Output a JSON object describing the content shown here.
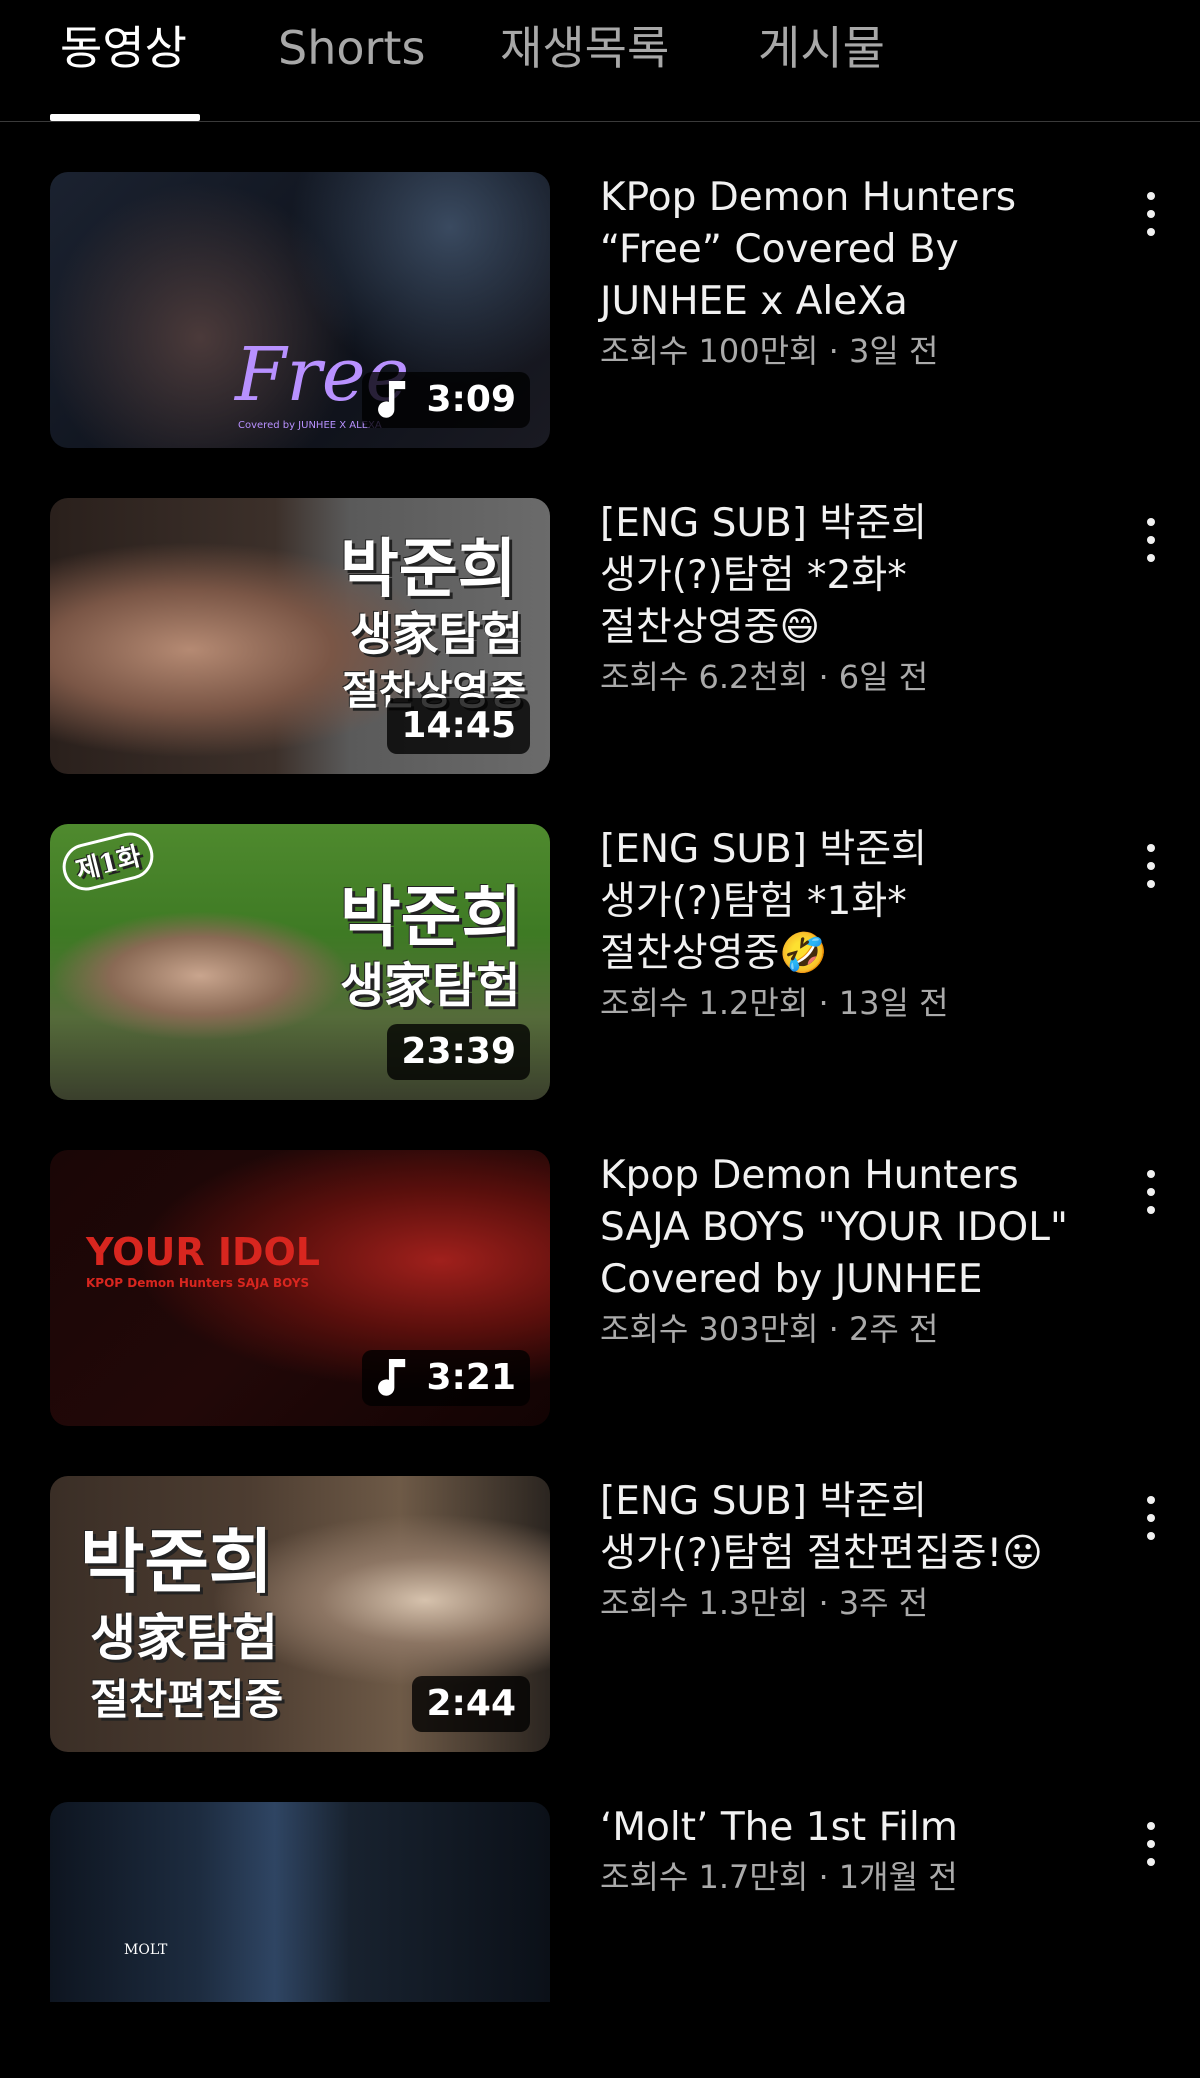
{
  "tabs": [
    {
      "label": "동영상",
      "active": true
    },
    {
      "label": "Shorts",
      "active": false
    },
    {
      "label": "재생목록",
      "active": false
    },
    {
      "label": "게시물",
      "active": false
    }
  ],
  "videos": [
    {
      "title_lines": [
        "KPop Demon Hunters",
        "“Free” Covered By",
        "JUNHEE x AleXa"
      ],
      "views": "조회수 100만회",
      "age": "3일 전",
      "duration": "3:09",
      "music": true,
      "thumb_text": [
        "Free",
        "Covered by JUNHEE X ALEXA"
      ]
    },
    {
      "title_lines": [
        "[ENG SUB] 박준희",
        "생가(?)탐험 *2화*",
        "절찬상영중😄"
      ],
      "views": "조회수 6.2천회",
      "age": "6일 전",
      "duration": "14:45",
      "music": false,
      "thumb_text": [
        "박준희",
        "생家탐험",
        "절찬상영중"
      ]
    },
    {
      "title_lines": [
        "[ENG SUB] 박준희",
        "생가(?)탐험 *1화*",
        "절찬상영중🤣"
      ],
      "views": "조회수 1.2만회",
      "age": "13일 전",
      "duration": "23:39",
      "music": false,
      "thumb_text": [
        "제1화",
        "박준희",
        "생家탐험"
      ]
    },
    {
      "title_lines": [
        "Kpop Demon Hunters",
        "SAJA BOYS \"YOUR IDOL\"",
        "Covered by JUNHEE"
      ],
      "views": "조회수 303만회",
      "age": "2주 전",
      "duration": "3:21",
      "music": true,
      "thumb_text": [
        "YOUR IDOL",
        "KPOP Demon Hunters SAJA BOYS"
      ]
    },
    {
      "title_lines": [
        "[ENG SUB] 박준희",
        "생가(?)탐험 절찬편집중!😛"
      ],
      "views": "조회수 1.3만회",
      "age": "3주 전",
      "duration": "2:44",
      "music": false,
      "thumb_text": [
        "박준희",
        "생家탐험",
        "절찬편집중"
      ]
    },
    {
      "title_lines": [
        "‘Molt’ The 1st Film"
      ],
      "views": "조회수 1.7만회",
      "age": "1개월 전",
      "duration": "",
      "music": false,
      "thumb_text": [
        "MOLT"
      ]
    }
  ],
  "colors": {
    "background": "#000000",
    "text_primary": "#f1f1f1",
    "text_secondary": "#aaaaaa",
    "tab_inactive": "#a8a8a8"
  },
  "icons": {
    "music": "music-note-icon",
    "more": "more-vert-icon"
  }
}
